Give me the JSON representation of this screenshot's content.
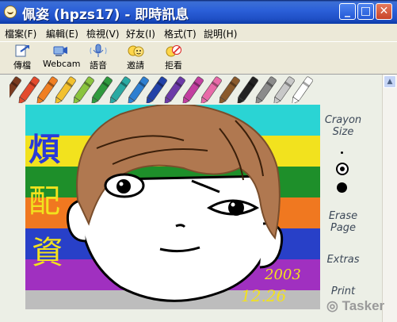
{
  "window": {
    "title": "佩姿 (hpzs17) - 即時訊息",
    "controls": {
      "minimize": "_",
      "maximize": "□",
      "close": "✕"
    }
  },
  "menu": [
    "檔案(F)",
    "編輯(E)",
    "檢視(V)",
    "好友(I)",
    "格式(T)",
    "說明(H)"
  ],
  "toolbar": [
    {
      "label": "傳檔",
      "icon": "file-transfer-icon"
    },
    {
      "label": "Webcam",
      "icon": "webcam-icon"
    },
    {
      "label": "語音",
      "icon": "microphone-icon"
    },
    {
      "label": "邀請",
      "icon": "invite-icon"
    },
    {
      "label": "拒看",
      "icon": "block-icon"
    }
  ],
  "crayons": [
    "#7a3b1f",
    "#e34a2c",
    "#f07f22",
    "#f2c12e",
    "#8ac43e",
    "#2f9a3e",
    "#2aa9a2",
    "#2e7fd1",
    "#2242a8",
    "#6c3aa8",
    "#c23ea0",
    "#e86aa8",
    "#8a5a2c",
    "#222222",
    "#8b8b8b",
    "#c8c8c8",
    "#ffffff"
  ],
  "side_panel": {
    "crayon_size": "Crayon Size",
    "erase_page": "Erase Page",
    "extras": "Extras",
    "print": "Print"
  },
  "drawing": {
    "handwriting_left": "煩配資",
    "date_line1": "2003",
    "date_line2": "12.26",
    "stripes": [
      "#2ad4d4",
      "#f2e21e",
      "#1e8f2a",
      "#f07820",
      "#2840c8",
      "#a030c0"
    ]
  },
  "watermark": "Tasker"
}
